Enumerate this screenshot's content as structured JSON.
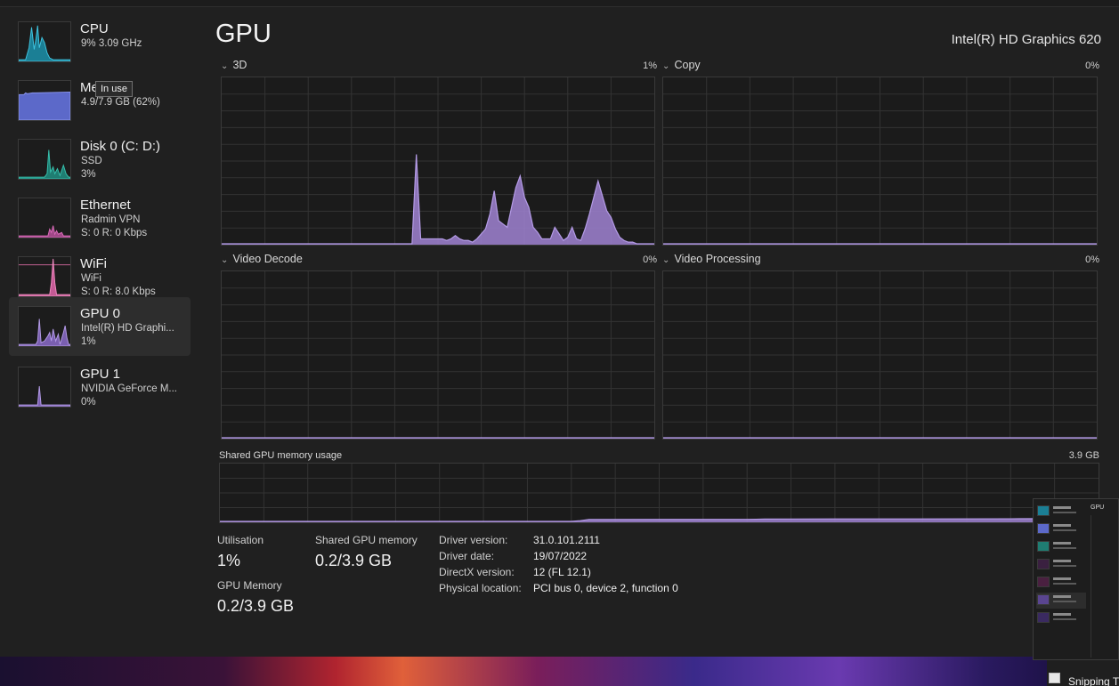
{
  "sidebar": {
    "items": [
      {
        "title": "CPU",
        "sub1": "9%  3.09 GHz",
        "sub2": "",
        "color": "#17a2c0",
        "selected": false
      },
      {
        "title": "Memory",
        "sub1": "4.9/7.9 GB (62%)",
        "sub2": "",
        "color": "#6e7bd6",
        "selected": false
      },
      {
        "title": "Disk 0 (C: D:)",
        "sub1": "SSD",
        "sub2": "3%",
        "color": "#2aa89a",
        "selected": false
      },
      {
        "title": "Ethernet",
        "sub1": "Radmin VPN",
        "sub2": "S: 0  R: 0 Kbps",
        "color": "#c25aa0",
        "selected": false
      },
      {
        "title": "WiFi",
        "sub1": "WiFi",
        "sub2": "S: 0  R: 8.0 Kbps",
        "color": "#e06aa8",
        "selected": false
      },
      {
        "title": "GPU 0",
        "sub1": "Intel(R) HD Graphi...",
        "sub2": "1%",
        "color": "#9a7ad0",
        "selected": true
      },
      {
        "title": "GPU 1",
        "sub1": "NVIDIA GeForce M...",
        "sub2": "0%",
        "color": "#9a7ad0",
        "selected": false
      }
    ],
    "tooltip": "In use"
  },
  "header": {
    "title": "GPU",
    "device": "Intel(R) HD Graphics 620"
  },
  "engines": [
    {
      "name": "3D",
      "percent": "1%"
    },
    {
      "name": "Copy",
      "percent": "0%"
    },
    {
      "name": "Video Decode",
      "percent": "0%"
    },
    {
      "name": "Video Processing",
      "percent": "0%"
    }
  ],
  "shared_memory_chart": {
    "label": "Shared GPU memory usage",
    "max": "3.9 GB"
  },
  "stats": {
    "utilisation_label": "Utilisation",
    "utilisation_value": "1%",
    "shared_label": "Shared GPU memory",
    "shared_value": "0.2/3.9 GB",
    "gpu_mem_label": "GPU Memory",
    "gpu_mem_value": "0.2/3.9 GB"
  },
  "info": [
    {
      "key": "Driver version:",
      "value": "31.0.101.2111"
    },
    {
      "key": "Driver date:",
      "value": "19/07/2022"
    },
    {
      "key": "DirectX version:",
      "value": "12 (FL 12.1)"
    },
    {
      "key": "Physical location:",
      "value": "PCI bus 0, device 2, function 0"
    }
  ],
  "preview": {
    "title": "GPU"
  },
  "taskbar": {
    "snipping_label": "Snipping T"
  },
  "chart_data": [
    {
      "type": "area",
      "title": "3D",
      "ylim": [
        0,
        100
      ],
      "x": [
        0,
        5,
        10,
        15,
        20,
        25,
        30,
        35,
        40,
        41,
        42,
        43,
        44,
        45,
        46,
        47,
        48,
        49,
        50,
        51,
        52,
        53,
        54,
        55,
        56,
        57,
        58,
        59,
        60,
        61,
        62,
        63,
        64,
        65,
        66,
        67,
        68,
        69,
        70,
        71,
        72,
        73,
        74,
        75,
        76,
        77,
        78,
        79,
        80,
        81,
        82,
        83,
        84,
        85,
        86,
        87,
        88,
        89,
        90,
        91,
        92,
        93,
        94,
        95,
        96,
        97,
        98,
        99,
        100
      ],
      "values": [
        0,
        0,
        0,
        0,
        0,
        0,
        0,
        0,
        0,
        0,
        0,
        0,
        0,
        54,
        3,
        3,
        3,
        3,
        3,
        3,
        2,
        3,
        5,
        3,
        2,
        2,
        1,
        3,
        6,
        9,
        18,
        32,
        14,
        12,
        10,
        22,
        34,
        41,
        28,
        22,
        10,
        7,
        3,
        3,
        3,
        10,
        6,
        2,
        4,
        10,
        3,
        2,
        9,
        18,
        28,
        38,
        29,
        20,
        16,
        9,
        4,
        2,
        1,
        1,
        0,
        0,
        0,
        0,
        0
      ]
    },
    {
      "type": "area",
      "title": "Copy",
      "ylim": [
        0,
        100
      ],
      "values": [
        0,
        0,
        0,
        0,
        0,
        0,
        0,
        0,
        0,
        0
      ]
    },
    {
      "type": "area",
      "title": "Video Decode",
      "ylim": [
        0,
        100
      ],
      "values": [
        0,
        0,
        0,
        0,
        0,
        0,
        0,
        0,
        0,
        0
      ]
    },
    {
      "type": "area",
      "title": "Video Processing",
      "ylim": [
        0,
        100
      ],
      "values": [
        0,
        0,
        0,
        0,
        0,
        0,
        0,
        0,
        0,
        0
      ]
    },
    {
      "type": "area",
      "title": "Shared GPU memory usage",
      "ylim": [
        0,
        3.9
      ],
      "x": [
        0,
        10,
        20,
        30,
        40,
        41,
        42,
        60,
        61,
        62,
        70,
        80,
        90,
        95,
        100
      ],
      "values": [
        0,
        0,
        0,
        0,
        0,
        0.05,
        0.13,
        0.14,
        0.15,
        0.16,
        0.17,
        0.17,
        0.18,
        0.19,
        0.19
      ]
    }
  ]
}
